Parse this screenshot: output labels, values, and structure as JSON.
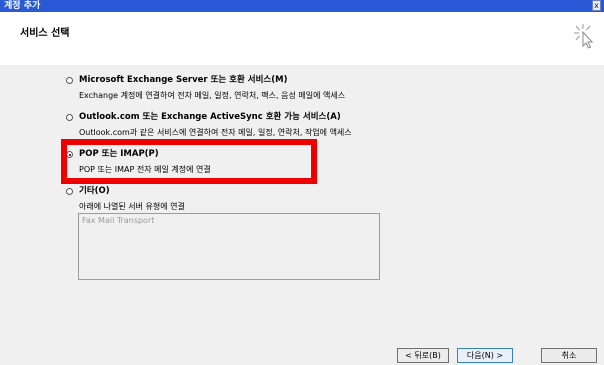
{
  "window": {
    "title": "계정 추가",
    "close_label": "x"
  },
  "header": {
    "title": "서비스 선택",
    "icon": "wizard-cursor-icon"
  },
  "options": [
    {
      "label": "Microsoft Exchange Server 또는 호환 서비스(M)",
      "description": "Exchange 계정에 연결하여 전자 메일, 일정, 연락처, 팩스, 음성 메일에 액세스",
      "selected": false
    },
    {
      "label": "Outlook.com 또는 Exchange ActiveSync 호환 가능 서비스(A)",
      "description": "Outlook.com과 같은 서비스에 연결하여 전자 메일, 일정, 연락처, 작업에 액세스",
      "selected": false
    },
    {
      "label": "POP 또는 IMAP(P)",
      "description": "POP 또는 IMAP 전자 메일 계정에 연결",
      "selected": true
    },
    {
      "label": "기타(O)",
      "description": "아래에 나열된 서버 유형에 연결",
      "selected": false
    }
  ],
  "server_types": [
    "Fax Mail Transport"
  ],
  "buttons": {
    "back": "< 뒤로(B)",
    "next": "다음(N) >",
    "cancel": "취소"
  },
  "colors": {
    "title_bar": "#2a59d6",
    "highlight": "#ee0000"
  }
}
